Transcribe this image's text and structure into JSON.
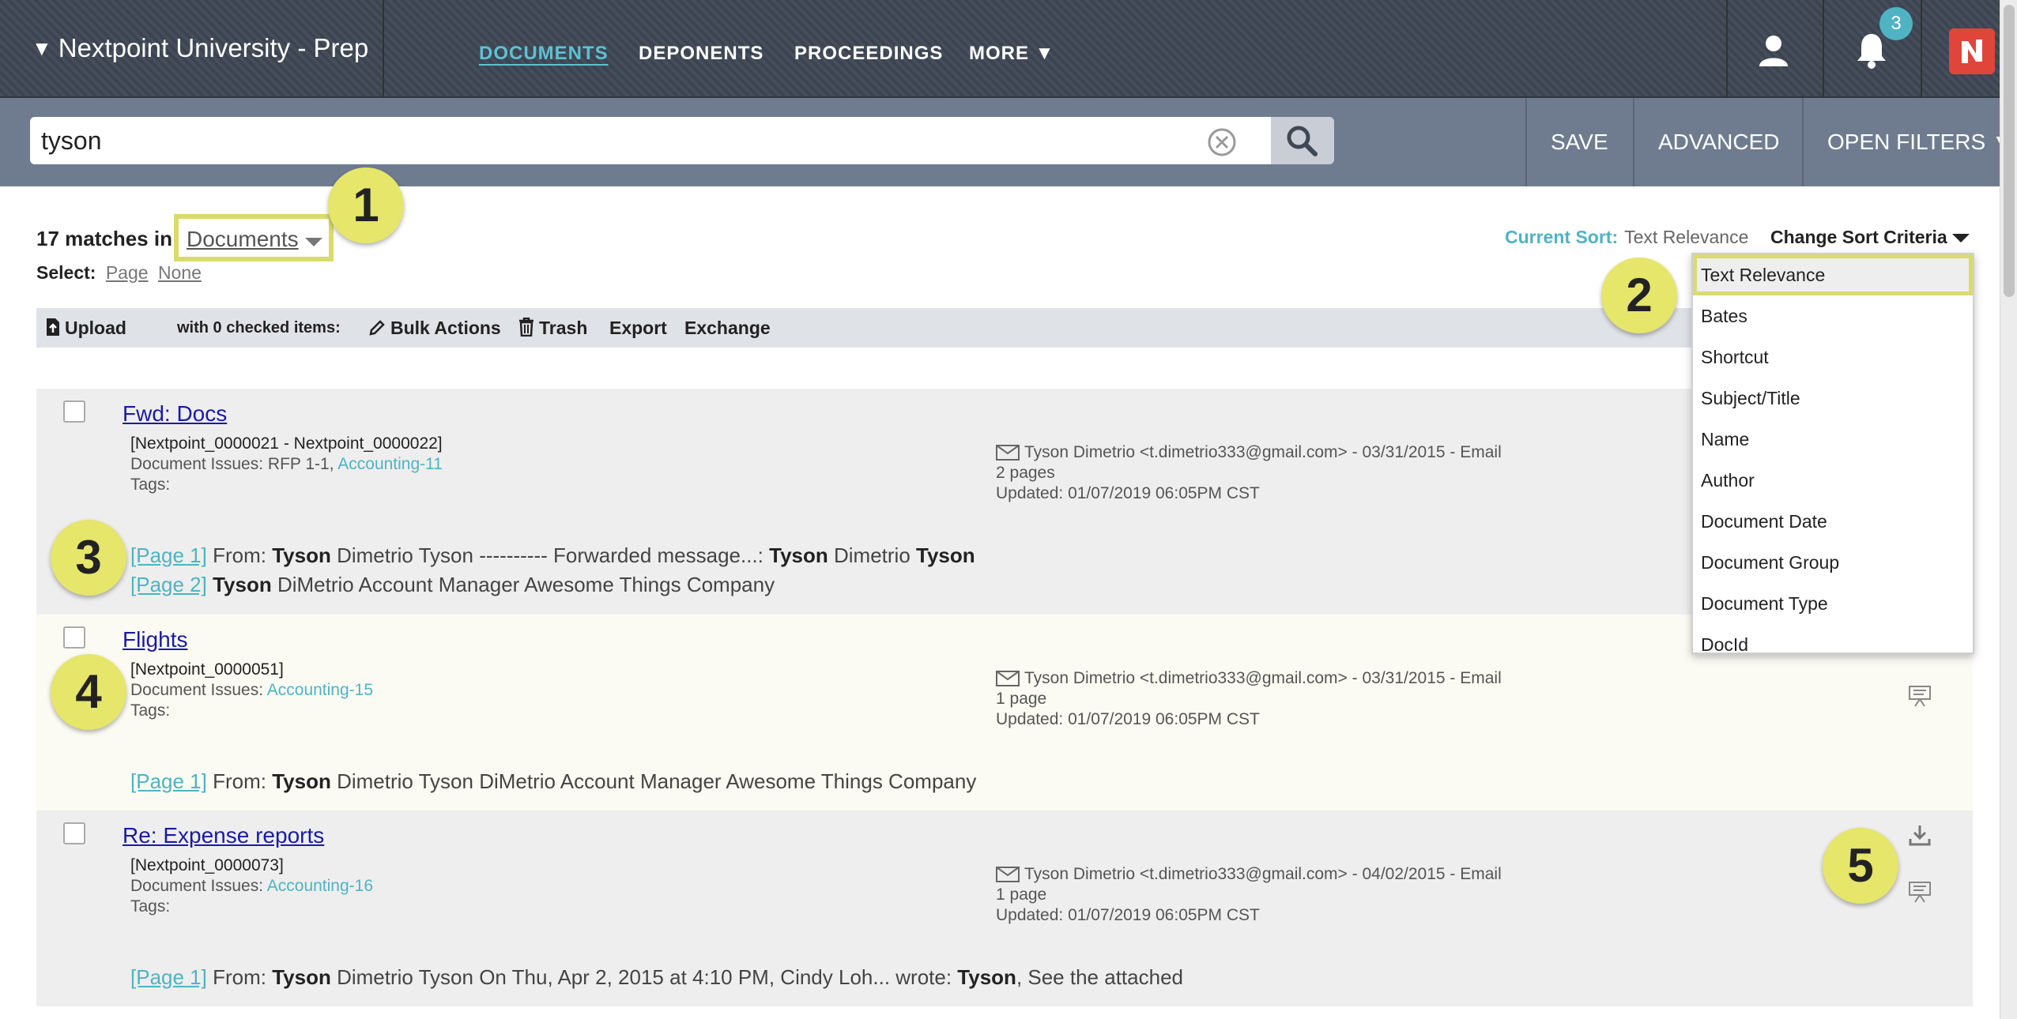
{
  "app": {
    "title": "Nextpoint University - Prep"
  },
  "nav": {
    "items": [
      {
        "label": "DOCUMENTS",
        "active": true
      },
      {
        "label": "DEPONENTS",
        "active": false
      },
      {
        "label": "PROCEEDINGS",
        "active": false
      },
      {
        "label": "MORE ▼",
        "active": false
      }
    ],
    "notification_count": "3",
    "icons": [
      "user-icon",
      "bell-icon",
      "nextpoint-logo"
    ]
  },
  "search": {
    "value": "tyson",
    "placeholder": ""
  },
  "search_actions": {
    "save": "SAVE",
    "advanced": "ADVANCED",
    "open_filters": "OPEN FILTERS ▼"
  },
  "results_header": {
    "count_text": "17 matches in",
    "collection": "Documents",
    "select_label": "Select:",
    "select_page": "Page",
    "select_none": "None",
    "current_sort_label": "Current Sort:",
    "current_sort_value": "Text Relevance",
    "change_sort": "Change Sort Criteria"
  },
  "toolbar": {
    "upload": "Upload",
    "checked_text": "with 0 checked items:",
    "bulk_actions": "Bulk Actions",
    "trash": "Trash",
    "export": "Export",
    "exchange": "Exchange"
  },
  "sort_options": [
    "Text Relevance",
    "Bates",
    "Shortcut",
    "Subject/Title",
    "Name",
    "Author",
    "Document Date",
    "Document Group",
    "Document Type",
    "DocId"
  ],
  "results": [
    {
      "title": "Fwd: Docs",
      "bates": "[Nextpoint_0000021 - Nextpoint_0000022]",
      "issues_label": "Document Issues:",
      "issues_plain": "RFP 1-1,",
      "issues_link": "Accounting-11",
      "tags_label": "Tags:",
      "from": "Tyson Dimetrio <t.dimetrio333@gmail.com> - 03/31/2015 - Email",
      "pages": "2 pages",
      "updated": "Updated: 01/07/2019 06:05PM CST",
      "snippets": [
        {
          "page": "[Page 1]",
          "pre": " From: ",
          "b1": "Tyson",
          "mid": " Dimetrio Tyson ---------- Forwarded message...: ",
          "b2": "Tyson",
          "mid2": " Dimetrio ",
          "b3": "Tyson",
          "post": ""
        },
        {
          "page": "[Page 2]",
          "pre": " ",
          "b1": "Tyson",
          "mid": " DiMetrio Account Manager Awesome Things Company",
          "b2": "",
          "mid2": "",
          "b3": "",
          "post": ""
        }
      ]
    },
    {
      "title": "Flights",
      "bates": "[Nextpoint_0000051]",
      "issues_label": "Document Issues:",
      "issues_plain": "",
      "issues_link": "Accounting-15",
      "tags_label": "Tags:",
      "from": "Tyson Dimetrio <t.dimetrio333@gmail.com> - 03/31/2015 - Email",
      "pages": "1 page",
      "updated": "Updated: 01/07/2019 06:05PM CST",
      "snippets": [
        {
          "page": "[Page 1]",
          "pre": " From: ",
          "b1": "Tyson",
          "mid": " Dimetrio Tyson DiMetrio Account Manager Awesome Things Company",
          "b2": "",
          "mid2": "",
          "b3": "",
          "post": ""
        }
      ]
    },
    {
      "title": "Re: Expense reports",
      "bates": "[Nextpoint_0000073]",
      "issues_label": "Document Issues:",
      "issues_plain": "",
      "issues_link": "Accounting-16",
      "tags_label": "Tags:",
      "from": "Tyson Dimetrio <t.dimetrio333@gmail.com> - 04/02/2015 - Email",
      "pages": "1 page",
      "updated": "Updated: 01/07/2019 06:05PM CST",
      "snippets": [
        {
          "page": "[Page 1]",
          "pre": " From: ",
          "b1": "Tyson",
          "mid": " Dimetrio Tyson On Thu, Apr 2, 2015 at 4:10 PM, Cindy Loh... wrote: ",
          "b2": "Tyson",
          "mid2": ", See the attached",
          "b3": "",
          "post": ""
        }
      ]
    }
  ],
  "markers": [
    "1",
    "2",
    "3",
    "4",
    "5"
  ],
  "colors": {
    "accent": "#4fb3c4",
    "highlight": "#dadb6b",
    "marker": "#e5e66a",
    "nav_bg": "#3f4855",
    "searchbar_bg": "#6f7c90",
    "brand": "#e0453a"
  }
}
